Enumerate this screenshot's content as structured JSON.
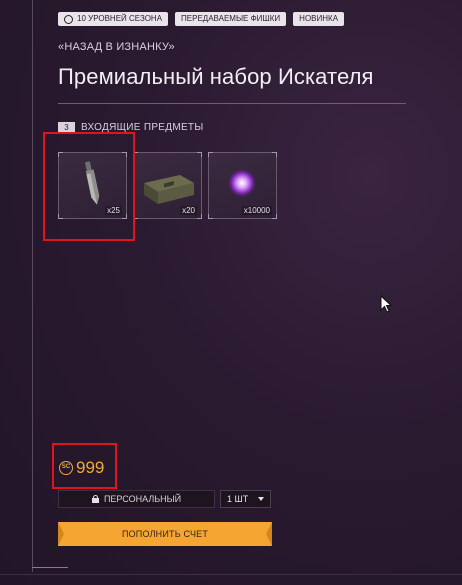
{
  "badges": [
    {
      "label": "10 УРОВНЕЙ СЕЗОНА",
      "icon": "season-icon"
    },
    {
      "label": "ПЕРЕДАВАЕМЫЕ ФИШКИ"
    },
    {
      "label": "НОВИНКА"
    }
  ],
  "back_link": "«НАЗАД В ИЗНАНКУ»",
  "title": "Премиальный набор Искателя",
  "section": {
    "count": "3",
    "label": "ВХОДЯЩИЕ ПРЕДМЕТЫ"
  },
  "items": [
    {
      "name": "knife",
      "qty": "x25"
    },
    {
      "name": "ammo-crate",
      "qty": "x20"
    },
    {
      "name": "purple-orb",
      "qty": "x10000"
    }
  ],
  "price": {
    "currency_icon": "SC",
    "value": "999",
    "color": "#f2a83c"
  },
  "ownership": {
    "label": "ПЕРСОНАЛЬНЫЙ",
    "icon": "lock-icon"
  },
  "quantity": {
    "selected": "1 ШТ"
  },
  "topup": {
    "label": "ПОПОЛНИТЬ СЧЕТ",
    "color": "#f5a531"
  }
}
